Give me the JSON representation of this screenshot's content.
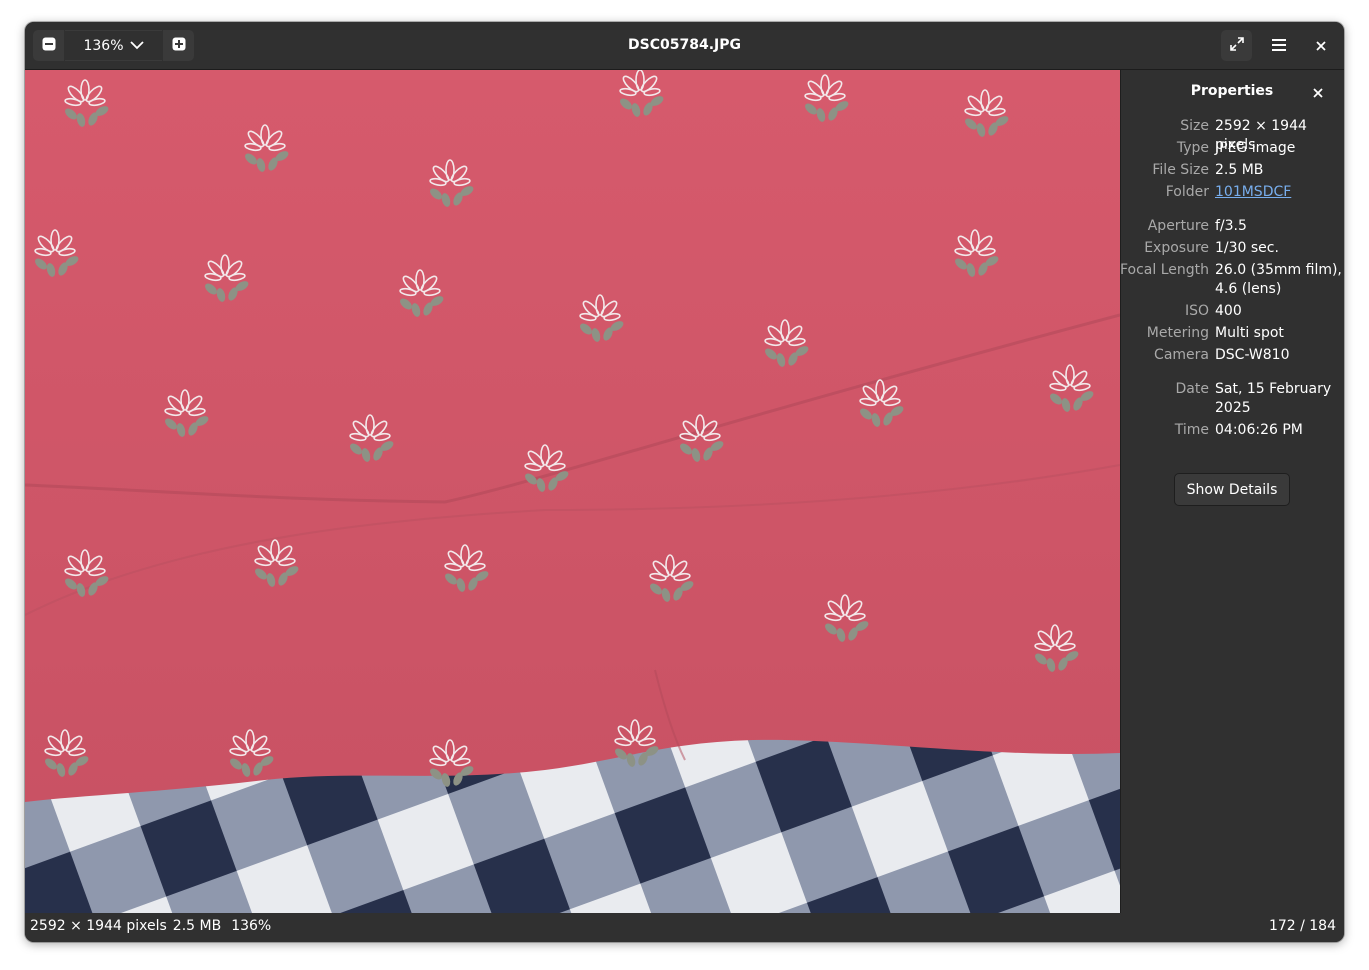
{
  "window": {
    "title": "DSC05784.JPG"
  },
  "headerbar": {
    "zoom_out_icon": "minus-square-icon",
    "zoom_level": "136%",
    "zoom_dropdown_icon": "chevron-down-icon",
    "zoom_in_icon": "plus-square-icon",
    "fullscreen_icon": "fullscreen-icon",
    "menu_icon": "hamburger-menu-icon",
    "close_icon": "close-icon"
  },
  "properties": {
    "title": "Properties",
    "rows": [
      {
        "label": "Size",
        "value": "2592 × 1944 pixels"
      },
      {
        "label": "Type",
        "value": "JPEG image"
      },
      {
        "label": "File Size",
        "value": "2.5 MB"
      },
      {
        "label": "Folder",
        "value": "101MSDCF"
      },
      {
        "label": "Aperture",
        "value": "f/3.5"
      },
      {
        "label": "Exposure",
        "value": "1/30 sec."
      },
      {
        "label": "Focal Length",
        "value_line1": "26.0 (35mm film),",
        "value_line2": "4.6 (lens)"
      },
      {
        "label": "ISO",
        "value": "400"
      },
      {
        "label": "Metering",
        "value": "Multi spot"
      },
      {
        "label": "Camera",
        "value": "DSC-W810"
      },
      {
        "label": "Date",
        "value_line1": "Sat, 15 February",
        "value_line2": "2025"
      },
      {
        "label": "Time",
        "value": "04:06:26 PM"
      }
    ],
    "show_details_label": "Show Details"
  },
  "statusbar": {
    "dimensions": "2592 × 1944 pixels",
    "file_size": "2.5 MB",
    "zoom": "136%",
    "position": "172 / 184"
  },
  "colors": {
    "window_bg": "#242424",
    "header_bg": "#303030",
    "link": "#78aeed",
    "label": "#a9a9a9",
    "fabric_pink": "#d45b6d",
    "checker_navy": "#2a3552"
  }
}
